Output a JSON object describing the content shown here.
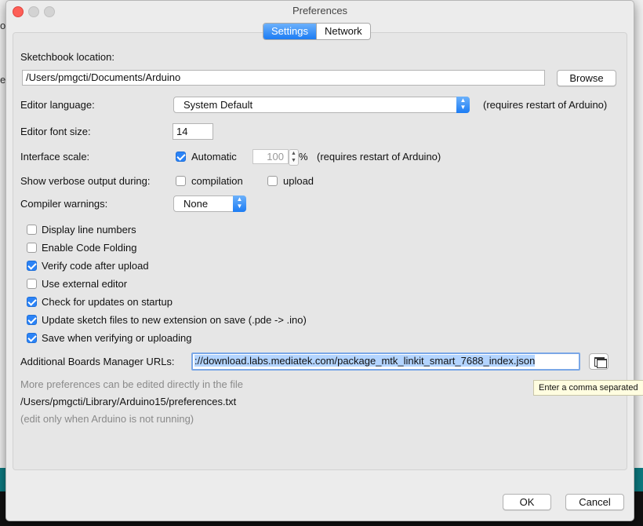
{
  "window": {
    "title": "Preferences"
  },
  "tabs": [
    {
      "label": "Settings",
      "active": true
    },
    {
      "label": "Network",
      "active": false
    }
  ],
  "sketchbook": {
    "label": "Sketchbook location:",
    "path": "/Users/pmgcti/Documents/Arduino",
    "browse_label": "Browse"
  },
  "editor_language": {
    "label": "Editor language:",
    "value": "System Default",
    "note": "(requires restart of Arduino)"
  },
  "font_size": {
    "label": "Editor font size:",
    "value": "14"
  },
  "interface_scale": {
    "label": "Interface scale:",
    "automatic_label": "Automatic",
    "automatic_checked": true,
    "value": "100",
    "unit": "%",
    "note": "(requires restart of Arduino)"
  },
  "verbose": {
    "label": "Show verbose output during:",
    "compilation_label": "compilation",
    "compilation_checked": false,
    "upload_label": "upload",
    "upload_checked": false
  },
  "compiler_warnings": {
    "label": "Compiler warnings:",
    "value": "None"
  },
  "options": [
    {
      "label": "Display line numbers",
      "checked": false
    },
    {
      "label": "Enable Code Folding",
      "checked": false
    },
    {
      "label": "Verify code after upload",
      "checked": true
    },
    {
      "label": "Use external editor",
      "checked": false
    },
    {
      "label": "Check for updates on startup",
      "checked": true
    },
    {
      "label": "Update sketch files to new extension on save (.pde -> .ino)",
      "checked": true
    },
    {
      "label": "Save when verifying or uploading",
      "checked": true
    }
  ],
  "boards_manager": {
    "label": "Additional Boards Manager URLs:",
    "value": "://download.labs.mediatek.com/package_mtk_linkit_smart_7688_index.json",
    "tooltip": "Enter a comma separated"
  },
  "footer": {
    "more_prefs": "More preferences can be edited directly in the file",
    "prefs_path": "/Users/pmgcti/Library/Arduino15/preferences.txt",
    "edit_note": "(edit only when Arduino is not running)"
  },
  "buttons": {
    "ok": "OK",
    "cancel": "Cancel"
  },
  "colors": {
    "accent": "#2b83f6",
    "selection": "#b3d4ff"
  },
  "background_app": {
    "fragment_1": "o",
    "fragment_2": "e"
  }
}
